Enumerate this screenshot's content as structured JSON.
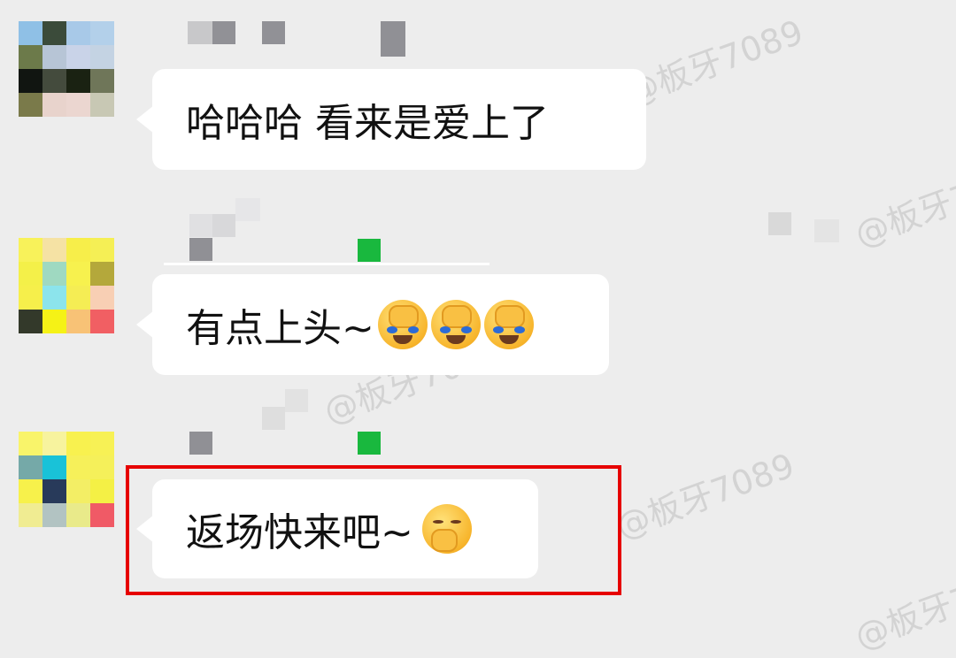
{
  "watermark": {
    "text": "@板牙7089"
  },
  "messages": [
    {
      "text": "哈哈哈  看来是爱上了",
      "emojis": []
    },
    {
      "text": "有点上头~",
      "emojis": [
        "facepalm-laugh-icon",
        "facepalm-laugh-icon",
        "facepalm-laugh-icon"
      ]
    },
    {
      "text": "返场快来吧~",
      "emojis": [
        "giggle-icon"
      ]
    }
  ],
  "colors": {
    "background": "#ededed",
    "bubble": "#ffffff",
    "highlight": "#e60000",
    "online_dot": "#19b83e"
  }
}
